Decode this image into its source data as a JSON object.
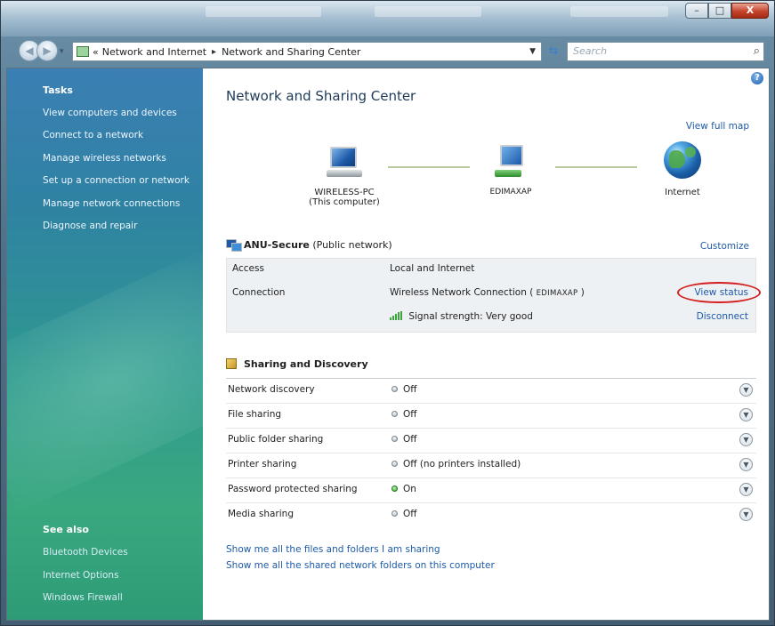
{
  "window": {
    "minimize_glyph": "–",
    "maximize_glyph": "□",
    "close_glyph": "X"
  },
  "address_bar": {
    "overflow_glyph": "«",
    "crumbs": [
      "Network and Internet",
      "Network and Sharing Center"
    ],
    "separator": "▸",
    "search_placeholder": "Search"
  },
  "sidebar": {
    "tasks_heading": "Tasks",
    "tasks": [
      "View computers and devices",
      "Connect to a network",
      "Manage wireless networks",
      "Set up a connection or network",
      "Manage network connections",
      "Diagnose and repair"
    ],
    "see_also_heading": "See also",
    "see_also": [
      "Bluetooth Devices",
      "Internet Options",
      "Windows Firewall"
    ]
  },
  "main": {
    "title": "Network and Sharing Center",
    "help_glyph": "?",
    "view_full_map": "View full map",
    "map": {
      "computer_name": "WIRELESS-PC",
      "computer_sub": "(This computer)",
      "access_point": "EDIMAXAP",
      "internet": "Internet"
    },
    "network": {
      "name": "ANU-Secure",
      "type": "(Public network)",
      "customize": "Customize",
      "access_label": "Access",
      "access_value": "Local and Internet",
      "connection_label": "Connection",
      "connection_value_prefix": "Wireless Network Connection (",
      "connection_ssid": "EDIMAXAP",
      "connection_value_suffix": ")",
      "view_status": "View status",
      "signal_label": "Signal strength:",
      "signal_value": "Very good",
      "disconnect": "Disconnect"
    },
    "sharing": {
      "heading": "Sharing and Discovery",
      "rows": [
        {
          "label": "Network discovery",
          "value": "Off",
          "on": false
        },
        {
          "label": "File sharing",
          "value": "Off",
          "on": false
        },
        {
          "label": "Public folder sharing",
          "value": "Off",
          "on": false
        },
        {
          "label": "Printer sharing",
          "value": "Off (no printers installed)",
          "on": false
        },
        {
          "label": "Password protected sharing",
          "value": "On",
          "on": true
        },
        {
          "label": "Media sharing",
          "value": "Off",
          "on": false
        }
      ]
    },
    "bottom_links": [
      "Show me all the files and folders I am sharing",
      "Show me all the shared network folders on this computer"
    ]
  },
  "colors": {
    "link": "#1e5aa8",
    "highlight_ellipse": "#d61e1e",
    "status_on": "#2ea02a"
  }
}
